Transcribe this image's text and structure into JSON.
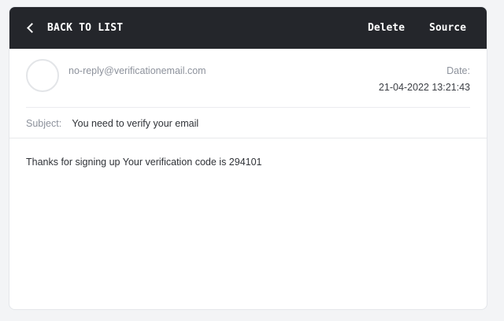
{
  "toolbar": {
    "back_label": "BACK TO LIST",
    "delete_label": "Delete",
    "source_label": "Source"
  },
  "email": {
    "from": "no-reply@verificationemail.com",
    "date_label": "Date:",
    "date": "21-04-2022 13:21:43",
    "subject_label": "Subject:",
    "subject": "You need to verify your email",
    "body": "Thanks for signing up Your verification code is 294101"
  },
  "colors": {
    "topbar_bg": "#24262b",
    "page_bg": "#f3f4f6",
    "muted_text": "#8d929c",
    "primary_text": "#2f3237"
  }
}
